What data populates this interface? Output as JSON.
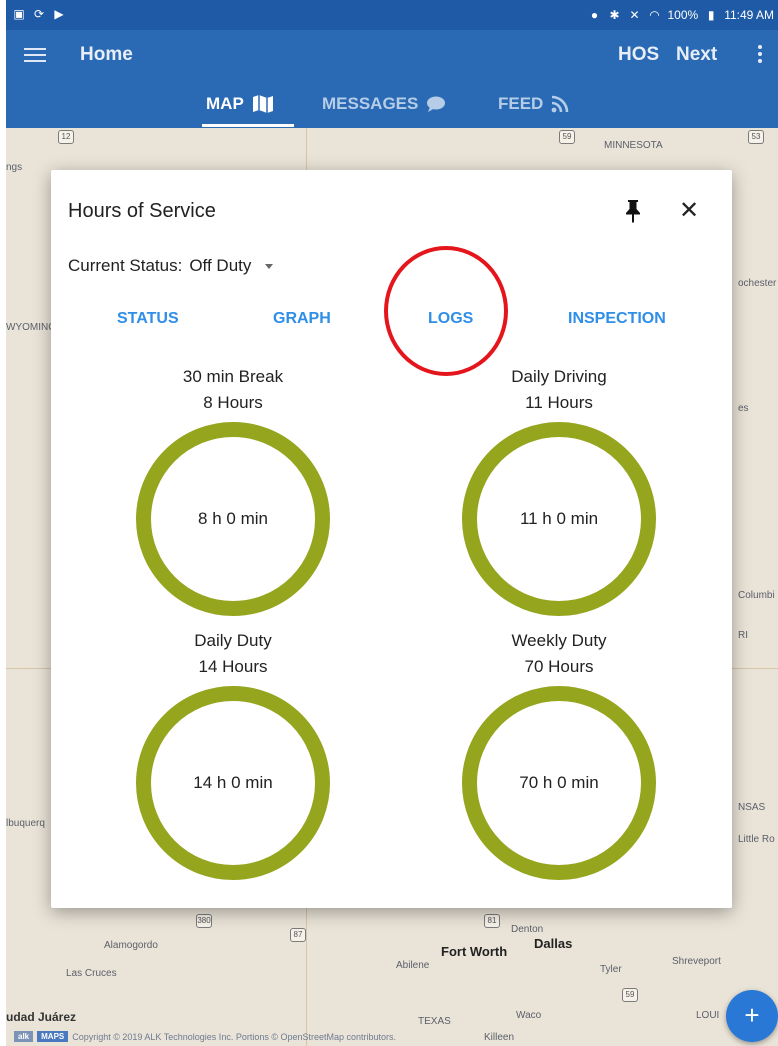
{
  "status_bar": {
    "battery": "100%",
    "time": "11:49 AM"
  },
  "app_bar": {
    "title": "Home",
    "hos_label": "HOS",
    "next_label": "Next",
    "tabs": [
      {
        "label": "MAP",
        "icon": "map-icon",
        "active": true
      },
      {
        "label": "MESSAGES",
        "icon": "chat-icon",
        "active": false
      },
      {
        "label": "FEED",
        "icon": "rss-icon",
        "active": false
      }
    ]
  },
  "map": {
    "labels": {
      "minnesota": "MINNESOTA",
      "wyoming": "WYOMING",
      "rochester": "ochester",
      "albuquerque": "lbuquerq",
      "alamogordo": "Alamogordo",
      "las_cruces": "Las Cruces",
      "ciudad_juarez": "udad Juárez",
      "fort_worth": "Fort Worth",
      "dallas": "Dallas",
      "denton": "Denton",
      "abilene": "Abilene",
      "tyler": "Tyler",
      "shreveport": "Shreveport",
      "texas": "TEXAS",
      "waco": "Waco",
      "killeen": "Killeen",
      "columbia": "Columbi",
      "little_rock": "Little Ro",
      "kansas_frag": "NSAS",
      "louis_frag": "LOUI",
      "es_frag": "es",
      "ri_frag": "RI",
      "ngs_frag": "ngs"
    },
    "copyright": "Copyright © 2019 ALK Technologies Inc. Portions © OpenStreetMap contributors.",
    "alk_badge": "alk",
    "maps_badge": "MAPS"
  },
  "dialog": {
    "title": "Hours of Service",
    "status_label": "Current Status:",
    "status_value": "Off Duty",
    "tabs": [
      "STATUS",
      "GRAPH",
      "LOGS",
      "INSPECTION"
    ],
    "gauges": [
      {
        "title": "30 min Break",
        "limit": "8 Hours",
        "remaining": "8 h 0 min"
      },
      {
        "title": "Daily Driving",
        "limit": "11 Hours",
        "remaining": "11 h 0 min"
      },
      {
        "title": "Daily Duty",
        "limit": "14 Hours",
        "remaining": "14 h 0 min"
      },
      {
        "title": "Weekly Duty",
        "limit": "70 Hours",
        "remaining": "70 h 0 min"
      }
    ]
  },
  "fab_label": "+"
}
